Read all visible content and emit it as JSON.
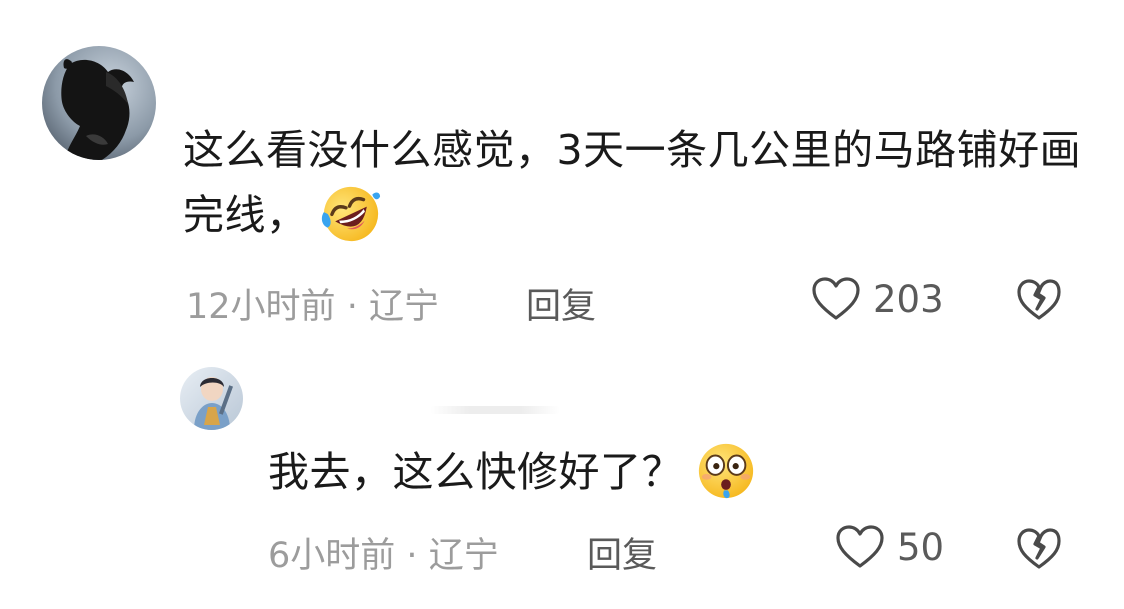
{
  "comments": [
    {
      "text": "这么看没什么感觉，3天一条几公里的马路铺好画完线，",
      "emoji": "rolling-on-floor-laughing-emoji",
      "time": "12小时前",
      "separator": "·",
      "location": "辽宁",
      "reply_label": "回复",
      "likes": "203",
      "avatar": "black-horse-avatar"
    },
    {
      "text": "我去，这么快修好了？",
      "emoji": "flushed-face-emoji",
      "time": "6小时前",
      "separator": "·",
      "location": "辽宁",
      "reply_label": "回复",
      "likes": "50",
      "avatar": "person-portrait-avatar"
    }
  ],
  "colors": {
    "meta_text": "#9c9c9c",
    "action_text": "#5a5a5a",
    "body_text": "#1a1a1a"
  }
}
